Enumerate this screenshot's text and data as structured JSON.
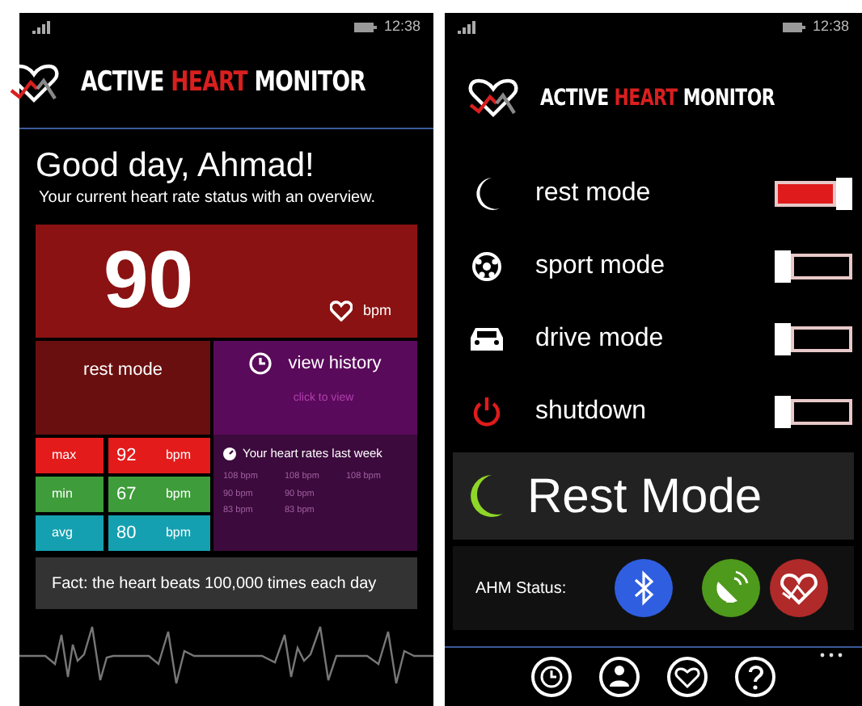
{
  "left_screen": {
    "status_bar": {
      "time": "12:38"
    },
    "title": {
      "before": "ACTIVE",
      "highlight": "HEART",
      "after": "MONITOR"
    },
    "greeting": "Good day, Ahmad!",
    "subtitle": "Your current heart rate status with an overview.",
    "heart_rate": {
      "value": "90",
      "unit": "bpm"
    },
    "mode_tile": {
      "label": "rest mode"
    },
    "history_tile": {
      "title": "view history",
      "hint": "click to view"
    },
    "stats": [
      {
        "label": "max",
        "value": "92",
        "unit": "bpm",
        "color": "#e31b1b"
      },
      {
        "label": "min",
        "value": "67",
        "unit": "bpm",
        "color": "#3e9c3a"
      },
      {
        "label": "avg",
        "value": "80",
        "unit": "bpm",
        "color": "#14a0b0"
      }
    ],
    "weekly": {
      "title": "Your heart rates last week",
      "rows": [
        [
          "108 bpm",
          "108 bpm",
          "108 bpm"
        ],
        [
          "90 bpm",
          "90 bpm"
        ],
        [
          "83 bpm",
          "83 bpm"
        ]
      ]
    },
    "fact": "Fact: the heart beats 100,000 times each day"
  },
  "right_screen": {
    "status_bar": {
      "time": "12:38"
    },
    "title": {
      "before": "ACTIVE",
      "highlight": "HEART",
      "after": "MONITOR"
    },
    "modes": [
      {
        "kind": "rest",
        "label": "rest mode",
        "on": true
      },
      {
        "kind": "sport",
        "label": "sport mode",
        "on": false
      },
      {
        "kind": "drive",
        "label": "drive mode",
        "on": false
      },
      {
        "kind": "shutdown",
        "label": "shutdown",
        "on": false
      }
    ],
    "current_mode": {
      "label": "Rest Mode"
    },
    "status": {
      "label": "AHM Status:"
    }
  }
}
